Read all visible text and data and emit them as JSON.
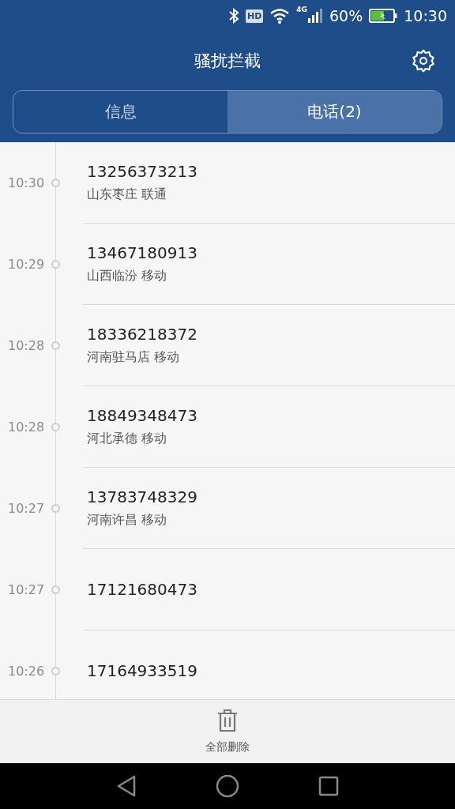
{
  "status_bar": {
    "hd": "HD",
    "network": "4G",
    "battery": "60%",
    "time": "10:30"
  },
  "header": {
    "title": "骚扰拦截"
  },
  "tabs": [
    {
      "label": "信息",
      "selected": false
    },
    {
      "label": "电话(2)",
      "selected": true
    }
  ],
  "calls": [
    {
      "time": "10:30",
      "number": "13256373213",
      "location": "山东枣庄 联通"
    },
    {
      "time": "10:29",
      "number": "13467180913",
      "location": "山西临汾 移动"
    },
    {
      "time": "10:28",
      "number": "18336218372",
      "location": "河南驻马店 移动"
    },
    {
      "time": "10:28",
      "number": "18849348473",
      "location": "河北承德 移动"
    },
    {
      "time": "10:27",
      "number": "13783748329",
      "location": "河南许昌 移动"
    },
    {
      "time": "10:27",
      "number": "17121680473"
    },
    {
      "time": "10:26",
      "number": "17164933519"
    }
  ],
  "bottom_action": {
    "label": "全部删除"
  }
}
